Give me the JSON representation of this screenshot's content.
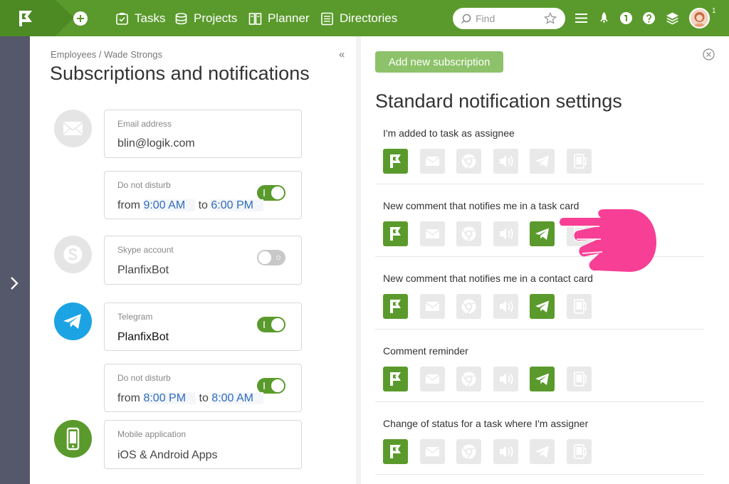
{
  "topbar": {
    "nav": [
      {
        "label": "Tasks",
        "icon": "tasks-icon"
      },
      {
        "label": "Projects",
        "icon": "projects-icon"
      },
      {
        "label": "Planner",
        "icon": "planner-icon"
      },
      {
        "label": "Directories",
        "icon": "directories-icon"
      }
    ],
    "search_placeholder": "Find",
    "notification_count": "1"
  },
  "left": {
    "breadcrumb": "Employees / Wade Strongs",
    "title": "Subscriptions and notifications",
    "email": {
      "label": "Email address",
      "value": "blin@logik.com"
    },
    "email_dnd": {
      "label": "Do not disturb",
      "from": "from",
      "from_time": "9:00 AM",
      "to": "to",
      "to_time": "6:00 PM",
      "enabled": true
    },
    "skype": {
      "label": "Skype account",
      "value": "PlanfixBot",
      "enabled": false
    },
    "telegram": {
      "label": "Telegram",
      "value": "PlanfixBot",
      "enabled": true
    },
    "telegram_dnd": {
      "label": "Do not disturb",
      "from": "from",
      "from_time": "8:00 PM",
      "to": "to",
      "to_time": "8:00 AM",
      "enabled": true
    },
    "mobile": {
      "label": "Mobile application",
      "value": "iOS & Android Apps"
    }
  },
  "right": {
    "add_button": "Add new subscription",
    "title": "Standard notification settings",
    "channels": [
      "planfix",
      "email",
      "browser",
      "sound",
      "telegram",
      "mobile"
    ],
    "notifications": [
      {
        "label": "I'm added to task as assignee",
        "active": [
          true,
          false,
          false,
          false,
          false,
          false
        ]
      },
      {
        "label": "New comment that notifies me in a task card",
        "active": [
          true,
          false,
          false,
          false,
          true,
          false
        ]
      },
      {
        "label": "New comment that notifies me in a contact card",
        "active": [
          true,
          false,
          false,
          false,
          true,
          false
        ]
      },
      {
        "label": "Comment reminder",
        "active": [
          true,
          false,
          false,
          false,
          true,
          false
        ]
      },
      {
        "label": "Change of status for a task where I'm assigner",
        "active": [
          true,
          false,
          false,
          false,
          false,
          false
        ]
      }
    ]
  },
  "colors": {
    "brand_green": "#5a9a2c",
    "telegram_blue": "#1ba3e3",
    "time_blue": "#2e6cbf",
    "pointer_pink": "#f73f95"
  }
}
